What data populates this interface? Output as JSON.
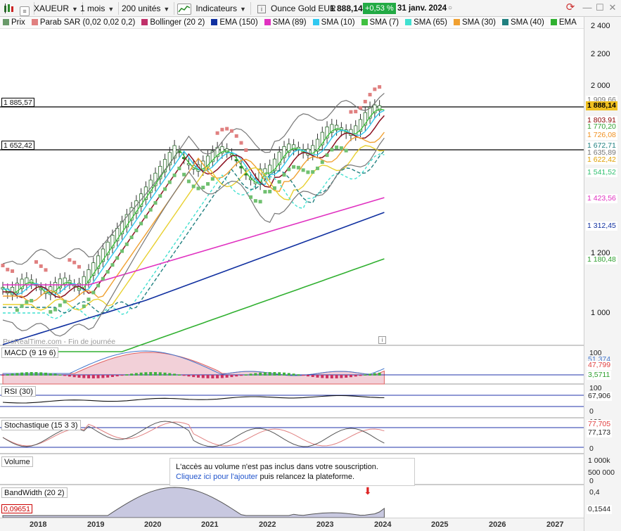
{
  "toolbar": {
    "symbol": "XAUEUR",
    "period": "1 mois",
    "units": "200 unités",
    "indicators": "Indicateurs",
    "instrument": "Ounce Gold EUR",
    "last_price": "1 888,14",
    "change": "+0,53 %",
    "date": "31 janv. 2024",
    "colors": {
      "change_bg": "#22aa44"
    }
  },
  "legend": [
    {
      "label": "Prix",
      "color": "#6a9a6a"
    },
    {
      "label": "Parab SAR (0,02 0,02 0,2)",
      "color": "#e08080"
    },
    {
      "label": "Bollinger (20 2)",
      "color": "#c0306a"
    },
    {
      "label": "EMA (150)",
      "color": "#1030a0"
    },
    {
      "label": "SMA (89)",
      "color": "#e030c0"
    },
    {
      "label": "SMA (10)",
      "color": "#30c8f0"
    },
    {
      "label": "SMA (7)",
      "color": "#40c040"
    },
    {
      "label": "SMA (65)",
      "color": "#40e0d0"
    },
    {
      "label": "SMA (30)",
      "color": "#f0a030"
    },
    {
      "label": "SMA (40)",
      "color": "#208080"
    },
    {
      "label": "EMA",
      "color": "#30b030"
    }
  ],
  "price_axis": [
    "2 400",
    "2 200",
    "2 000",
    "1 200",
    "1 000"
  ],
  "price_tags": [
    {
      "v": "1 909,66",
      "bg": "#ffffff",
      "fg": "#777777"
    },
    {
      "v": "1 888,14",
      "bg": "#f0c020",
      "fg": "#000000"
    },
    {
      "v": "1 803,91",
      "bg": "#ffffff",
      "fg": "#8b0000"
    },
    {
      "v": "1 770,20",
      "bg": "#ffffff",
      "fg": "#30a030"
    },
    {
      "v": "1 726,08",
      "bg": "#ffffff",
      "fg": "#f09020"
    },
    {
      "v": "1 672,71",
      "bg": "#ffffff",
      "fg": "#208080"
    },
    {
      "v": "1 635,89",
      "bg": "#ffffff",
      "fg": "#777777"
    },
    {
      "v": "1 622,42",
      "bg": "#ffffff",
      "fg": "#e0a000"
    },
    {
      "v": "1 541,52",
      "bg": "#ffffff",
      "fg": "#30c070"
    },
    {
      "v": "1 423,56",
      "bg": "#ffffff",
      "fg": "#e030c0"
    },
    {
      "v": "1 312,45",
      "bg": "#ffffff",
      "fg": "#1030a0"
    },
    {
      "v": "1 180,48",
      "bg": "#ffffff",
      "fg": "#30a030"
    }
  ],
  "hlines": [
    "1 885,57",
    "1 652,42"
  ],
  "watermark": "ProRealTime.com - Fin de journée",
  "panes": {
    "macd": {
      "title": "MACD (9 19 6)",
      "axis": "100",
      "v1": "51,374",
      "v2": "47,799",
      "v3": "3,5711"
    },
    "rsi": {
      "title": "RSI (30)",
      "axis_top": "100",
      "value": "67,906",
      "axis_bottom": "0"
    },
    "stoch": {
      "title": "Stochastique (15 3 3)",
      "axis_top": "100",
      "v1": "77,705",
      "v2": "77,173",
      "axis_bottom": "0"
    },
    "volume": {
      "title": "Volume",
      "axis_top": "1 000k",
      "axis_mid": "500 000",
      "axis_bottom": "0"
    },
    "bandwidth": {
      "title": "BandWidth (20 2)",
      "axis_top": "0,4",
      "value": "0,1544",
      "left_value": "0,09651"
    }
  },
  "volume_message": {
    "line1": "L'accès au volume n'est pas inclus dans votre souscription.",
    "link": "Cliquez ici pour l'ajouter",
    "line2_rest": " puis relancez la plateforme."
  },
  "years": [
    "2018",
    "2019",
    "2020",
    "2021",
    "2022",
    "2023",
    "2024",
    "2025",
    "2026",
    "2027"
  ]
}
